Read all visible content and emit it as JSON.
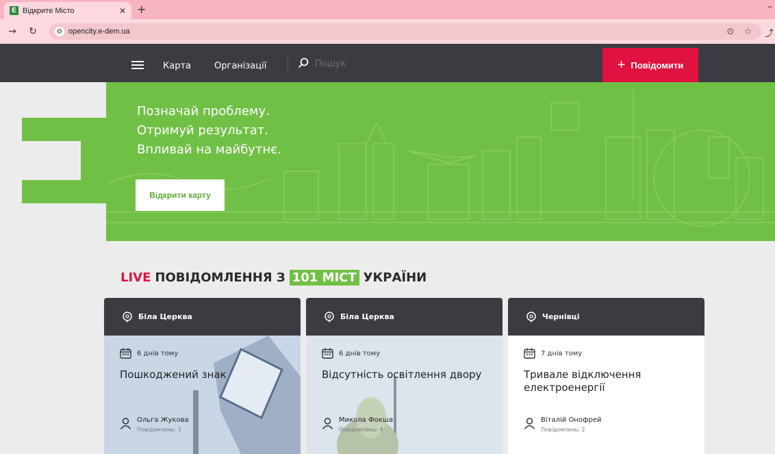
{
  "browser": {
    "tab_title": "Відкрите Місто",
    "favicon_letter": "E",
    "url": "opencity.e-dem.ua"
  },
  "header": {
    "nav": [
      "Карта",
      "Організації"
    ],
    "search_placeholder": "Пошук",
    "report_label": "Повідомити"
  },
  "hero": {
    "lines": [
      "Позначай проблему.",
      "Отримуй результат.",
      "Впливай на майбутнє."
    ],
    "button_label": "Відкрити карту"
  },
  "live": {
    "prefix": "LIVE",
    "middle": "ПОВІДОМЛЕННЯ З",
    "highlight": "101 МІСТ",
    "suffix": "УКРАЇНИ"
  },
  "cards": [
    {
      "city": "Біла Церква",
      "date": "6 днів тому",
      "title": "Пошкоджений знак",
      "author": "Ольга Жукова",
      "count": "Повідомлень: 3"
    },
    {
      "city": "Біла Церква",
      "date": "6 днів тому",
      "title": "Відсутність освітлення двору",
      "author": "Микола Фокша",
      "count": "Повідомлень: 4"
    },
    {
      "city": "Чернівці",
      "date": "7 днів тому",
      "title": "Тривале відключення електроенергії",
      "author": "Віталій Онофрей",
      "count": "Повідомлень: 2"
    }
  ],
  "colors": {
    "green": "#71c046",
    "red": "#e0123f",
    "dark": "#3b3c41"
  }
}
